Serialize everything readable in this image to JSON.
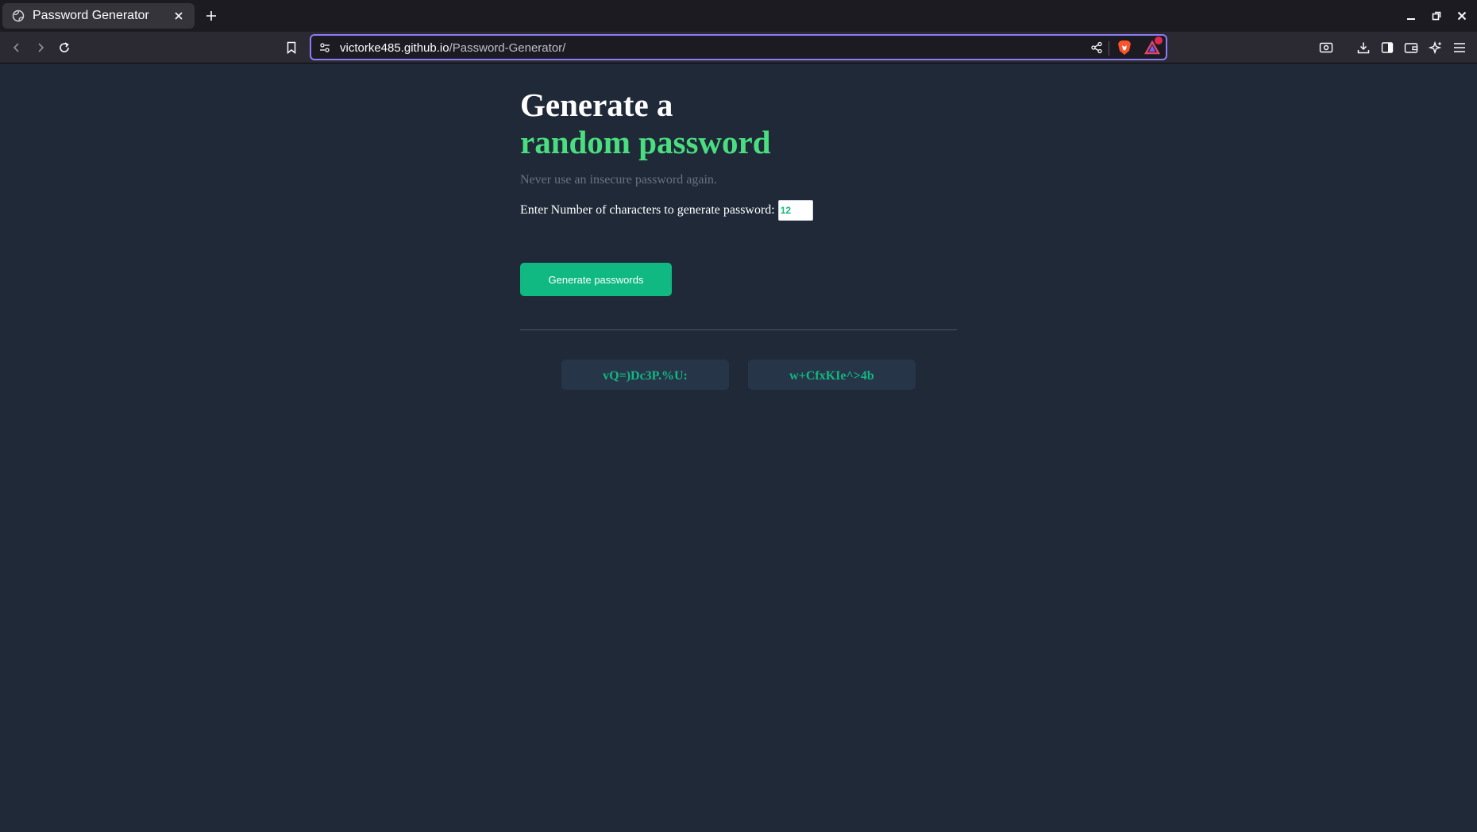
{
  "browser": {
    "tab_title": "Password Generator",
    "url_host": "victorke485.github.io",
    "url_path": "/Password-Generator/"
  },
  "page": {
    "heading_line1": "Generate a",
    "heading_line2": "random password",
    "subtitle": "Never use an insecure password again.",
    "length_label": "Enter Number of characters to generate password:",
    "length_value": "12",
    "generate_button": "Generate passwords",
    "passwords": [
      "vQ=)Dc3P.%U:",
      "w+CfxKIe^>4b"
    ]
  },
  "colors": {
    "background": "#1f2937",
    "accent_green": "#4ade80",
    "button_green": "#10b981",
    "password_box": "#273549"
  },
  "icons": [
    "globe-icon",
    "close-icon",
    "plus-icon",
    "back-icon",
    "forward-icon",
    "reload-icon",
    "bookmark-icon",
    "site-info-icon",
    "share-icon",
    "brave-shield-icon",
    "brave-rewards-icon",
    "screenshot-icon",
    "download-icon",
    "sidebar-icon",
    "wallet-icon",
    "leo-ai-icon",
    "menu-icon",
    "minimize-icon",
    "maximize-icon",
    "window-close-icon"
  ]
}
